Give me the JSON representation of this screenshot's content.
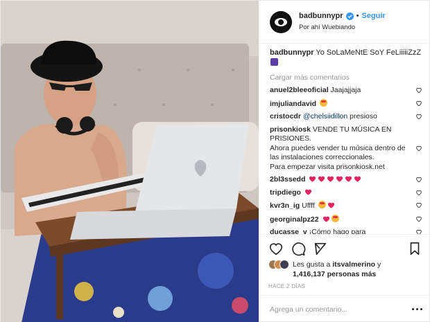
{
  "header": {
    "username": "badbunnypr",
    "separator": "•",
    "follow_label": "Seguir",
    "location": "Por ahí Wuebiando",
    "verified_icon": "verified-badge-icon",
    "accent_color": "#3897f0"
  },
  "caption": {
    "username": "badbunnypr",
    "text": "Yo SoLaMeNtE SoY FeLiiiiiZzZ",
    "emoji": "purple-emoji-icon"
  },
  "load_more_label": "Cargar más comentarios",
  "comments": [
    {
      "username": "anuel2bleeoficial",
      "text": "Jaajajjaja",
      "emojis": []
    },
    {
      "username": "imjuliandavid",
      "text": "",
      "emojis": [
        "face-emoji"
      ]
    },
    {
      "username": "cristocdr",
      "mention": "@chelsiidillon",
      "text": "presioso",
      "emojis": []
    },
    {
      "username": "prisonkiosk",
      "text": "VENDE TU MÚSICA EN PRISIONES.",
      "line2": "Ahora puedes vender tu música dentro de las instalaciones correccionales.",
      "line3": "Para empezar visita prisonkiosk.net",
      "emojis": []
    },
    {
      "username": "2bl3ssedd",
      "text": "",
      "emojis": [
        "heart",
        "heart",
        "heart",
        "heart",
        "heart",
        "heart"
      ]
    },
    {
      "username": "tripdiego",
      "text": "",
      "emojis": [
        "heart"
      ]
    },
    {
      "username": "kvr3n_ig",
      "text": "Uffff",
      "emojis": [
        "face-emoji",
        "heart"
      ]
    },
    {
      "username": "georginalpz22",
      "text": "",
      "emojis": [
        "heart",
        "face-emoji"
      ]
    },
    {
      "username": "ducasse_v",
      "text": "¡Cómo hago para",
      "emojis": []
    }
  ],
  "actions": {
    "like_icon": "heart-outline-icon",
    "comment_icon": "comment-icon",
    "share_icon": "share-icon",
    "save_icon": "bookmark-icon"
  },
  "likes": {
    "prefix": "Les gusta a",
    "user": "itsvalmerino",
    "connector": "y",
    "count": "1,416,137",
    "suffix": "personas más"
  },
  "date": "HACE 2 DÍAS",
  "add_comment": {
    "placeholder": "Agrega un comentario...",
    "more_icon": "more-options-icon"
  }
}
